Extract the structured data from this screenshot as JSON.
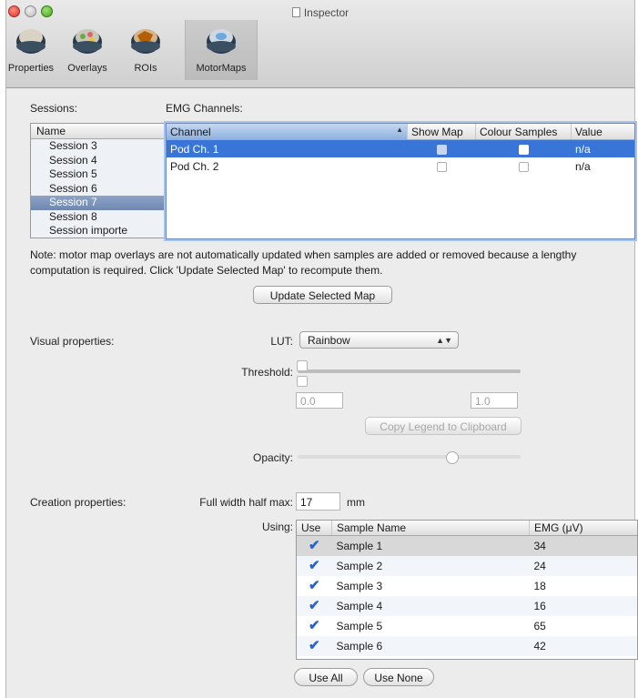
{
  "window": {
    "title": "Inspector"
  },
  "toolbar": [
    {
      "label": "Properties",
      "icon": "properties-icon",
      "selected": false
    },
    {
      "label": "Overlays",
      "icon": "overlays-icon",
      "selected": false
    },
    {
      "label": "ROIs",
      "icon": "rois-icon",
      "selected": false
    },
    {
      "label": "MotorMaps",
      "icon": "motormaps-icon",
      "selected": true
    }
  ],
  "sessions": {
    "label": "Sessions:",
    "header": "Name",
    "items": [
      "Session 3",
      "Session 4",
      "Session 5",
      "Session 6",
      "Session 7",
      "Session 8",
      "Session importe"
    ],
    "selected_index": 4
  },
  "emg": {
    "label": "EMG Channels:",
    "columns": [
      "Channel",
      "Show Map",
      "Colour Samples",
      "Value"
    ],
    "rows": [
      {
        "channel": "Pod Ch. 1",
        "show_map": true,
        "colour_samples": false,
        "value": "n/a",
        "selected": true
      },
      {
        "channel": "Pod Ch. 2",
        "show_map": false,
        "colour_samples": false,
        "value": "n/a",
        "selected": false
      }
    ]
  },
  "note": "Note: motor map overlays are not automatically updated when samples are added or removed because a lengthy computation is required. Click 'Update Selected Map' to recompute them.",
  "update_button": "Update Selected Map",
  "visual": {
    "label": "Visual properties:",
    "lut_label": "LUT:",
    "lut_value": "Rainbow",
    "threshold_label": "Threshold:",
    "threshold_min": "0.0",
    "threshold_max": "1.0",
    "copy_legend_button": "Copy Legend to Clipboard",
    "opacity_label": "Opacity:",
    "opacity_level": 0.69
  },
  "creation": {
    "label": "Creation properties:",
    "fwhm_label": "Full width half max:",
    "fwhm_value": "17",
    "fwhm_unit": "mm",
    "using_label": "Using:",
    "columns": [
      "Use",
      "Sample Name",
      "EMG (μV)"
    ],
    "samples": [
      {
        "use": true,
        "name": "Sample 1",
        "emg": "34"
      },
      {
        "use": true,
        "name": "Sample 2",
        "emg": "24"
      },
      {
        "use": true,
        "name": "Sample 3",
        "emg": "18"
      },
      {
        "use": true,
        "name": "Sample 4",
        "emg": "16"
      },
      {
        "use": true,
        "name": "Sample 5",
        "emg": "65"
      },
      {
        "use": true,
        "name": "Sample 6",
        "emg": "42"
      }
    ],
    "use_all_button": "Use All",
    "use_none_button": "Use None"
  }
}
